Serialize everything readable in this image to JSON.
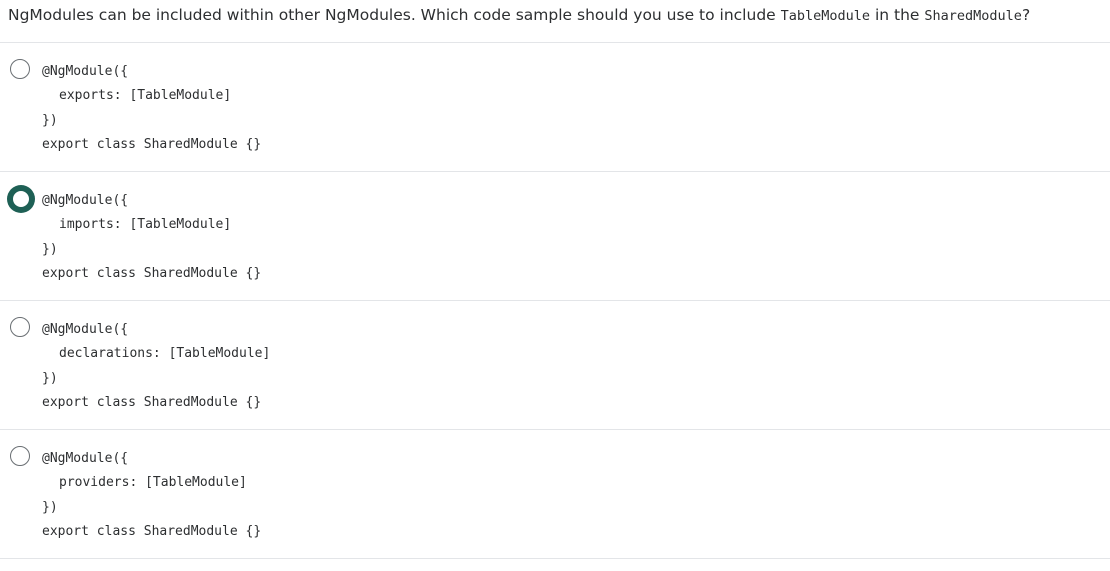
{
  "question": {
    "prefix": "NgModules can be included within other NgModules. Which code sample should you use to include ",
    "code1": "TableModule",
    "middle": " in the ",
    "code2": "SharedModule",
    "suffix": "?"
  },
  "options": [
    {
      "line1": "@NgModule({",
      "line2": "exports: [TableModule]",
      "line3": "})",
      "line4": "export class SharedModule {}",
      "selected": false
    },
    {
      "line1": "@NgModule({",
      "line2": "imports: [TableModule]",
      "line3": "})",
      "line4": "export class SharedModule {}",
      "selected": true
    },
    {
      "line1": "@NgModule({",
      "line2": "declarations: [TableModule]",
      "line3": "})",
      "line4": "export class SharedModule {}",
      "selected": false
    },
    {
      "line1": "@NgModule({",
      "line2": "providers: [TableModule]",
      "line3": "})",
      "line4": "export class SharedModule {}",
      "selected": false
    }
  ],
  "colors": {
    "selected_radio": "#1e6055",
    "divider": "#e3e5e8",
    "text": "#2d2f31"
  }
}
